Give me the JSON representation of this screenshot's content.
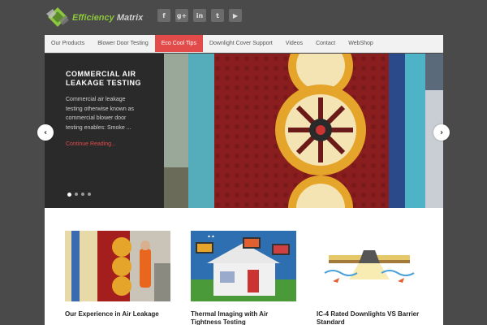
{
  "header": {
    "logo": {
      "text_part1": "Efficiency",
      "text_part2": "Matrix"
    },
    "social": [
      {
        "icon": "facebook-icon",
        "glyph": "f"
      },
      {
        "icon": "google-plus-icon",
        "glyph": "g+"
      },
      {
        "icon": "linkedin-icon",
        "glyph": "in"
      },
      {
        "icon": "twitter-icon",
        "glyph": "t"
      },
      {
        "icon": "youtube-icon",
        "glyph": "▶"
      }
    ]
  },
  "nav": {
    "items": [
      {
        "label": "Our Products"
      },
      {
        "label": "Blower Door Testing"
      },
      {
        "label": "Eco Cool Tips"
      },
      {
        "label": "Downlight Cover Support"
      },
      {
        "label": "Videos"
      },
      {
        "label": "Contact"
      },
      {
        "label": "WebShop"
      }
    ],
    "active_index": 2,
    "active_color": "#e34b4b"
  },
  "slider": {
    "title": "Commercial Air Leakage Testing",
    "text": "Commercial air leakage testing otherwise known as commercial blower door testing enables: Smoke ...",
    "link": "Continue Reading...",
    "dots_count": 4,
    "active_dot": 0,
    "prev_icon": "chevron-left-icon",
    "next_icon": "chevron-right-icon"
  },
  "posts": [
    {
      "title": "Our Experience in Air Leakage"
    },
    {
      "title": "Thermal Imaging with Air Tightness Testing"
    },
    {
      "title": "IC-4 Rated Downlights VS Barrier Standard"
    }
  ],
  "colors": {
    "accent": "#e34b4b",
    "logo_green": "#8dc63f",
    "background": "#4a4a4a"
  }
}
